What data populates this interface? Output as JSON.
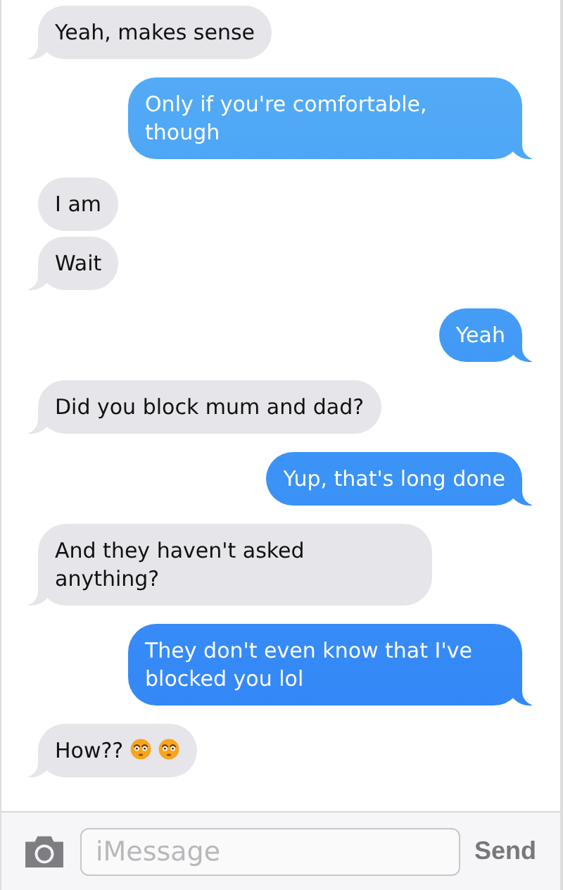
{
  "messages": [
    {
      "kind": "received",
      "text": "Yeah, makes sense",
      "tail": true
    },
    {
      "kind": "sent",
      "text": "Only if you're comfortable, though",
      "tail": true
    },
    {
      "kind": "received",
      "text": "I am",
      "tail": false
    },
    {
      "kind": "received",
      "text": "Wait",
      "tail": true
    },
    {
      "kind": "sent",
      "text": "Yeah",
      "tail": true
    },
    {
      "kind": "received",
      "text": "Did you block mum and dad?",
      "tail": true
    },
    {
      "kind": "sent",
      "text": "Yup, that's long done",
      "tail": true
    },
    {
      "kind": "received",
      "text": "And they haven't asked anything?",
      "tail": true
    },
    {
      "kind": "sent",
      "text": "They don't even know that I've blocked you lol",
      "tail": true
    },
    {
      "kind": "received",
      "text": "How??",
      "emojis": [
        {
          "kind": "flushed"
        },
        {
          "kind": "flushed"
        }
      ],
      "tail": true
    }
  ],
  "composer": {
    "placeholder": "iMessage",
    "send": "Send"
  }
}
